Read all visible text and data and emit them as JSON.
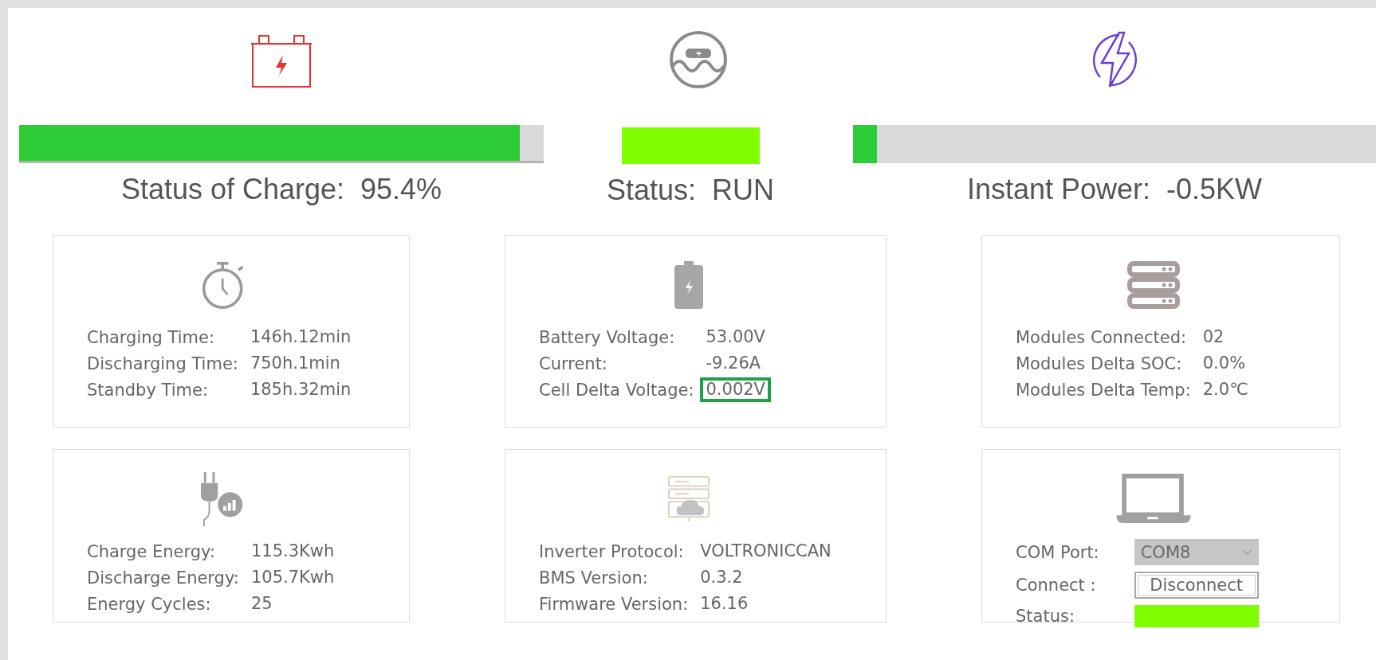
{
  "summary": [
    {
      "kind": "bar",
      "label": "Status of Charge:",
      "value": "95.4%",
      "level": 0.954
    },
    {
      "kind": "status",
      "label": "Status:",
      "value": "RUN",
      "active": true
    },
    {
      "kind": "bar",
      "label": "Instant Power:",
      "value": "-0.5KW",
      "level": 0.045
    }
  ],
  "cards": [
    {
      "kind": "rows",
      "rows": [
        {
          "label": "Charging Time:",
          "value": "146h.12min",
          "highlighted": false
        },
        {
          "label": "Discharging Time:",
          "value": "750h.1min",
          "highlighted": false
        },
        {
          "label": "Standby Time:",
          "value": "185h.32min",
          "highlighted": false
        }
      ]
    },
    {
      "kind": "rows",
      "rows": [
        {
          "label": "Battery Voltage:",
          "value": "53.00V",
          "highlighted": false
        },
        {
          "label": "Current:",
          "value": "-9.26A",
          "highlighted": false
        },
        {
          "label": "Cell Delta Voltage:",
          "value": "0.002V",
          "highlighted": true
        }
      ]
    },
    {
      "kind": "rows",
      "rows": [
        {
          "label": "Modules Connected:",
          "value": "02",
          "highlighted": false
        },
        {
          "label": "Modules Delta SOC:",
          "value": "0.0%",
          "highlighted": false
        },
        {
          "label": "Modules Delta Temp:",
          "value": "2.0℃",
          "highlighted": false
        }
      ]
    },
    {
      "kind": "rows",
      "rows": [
        {
          "label": "Charge Energy:",
          "value": "115.3Kwh",
          "highlighted": false
        },
        {
          "label": "Discharge Energy:",
          "value": "105.7Kwh",
          "highlighted": false
        },
        {
          "label": "Energy Cycles:",
          "value": "25",
          "highlighted": false
        }
      ]
    },
    {
      "kind": "rows",
      "rows": [
        {
          "label": "Inverter Protocol:",
          "value": "VOLTRONICCAN",
          "highlighted": false
        },
        {
          "label": "BMS Version:",
          "value": "0.3.2",
          "highlighted": false
        },
        {
          "label": "Firmware Version:",
          "value": "16.16",
          "highlighted": false
        }
      ]
    },
    {
      "kind": "connection",
      "com_port": {
        "label": "COM Port:",
        "value": "COM8"
      },
      "connect": {
        "label": "Connect :",
        "button": "Disconnect"
      },
      "status": {
        "label": "Status:",
        "active": true
      }
    }
  ]
}
